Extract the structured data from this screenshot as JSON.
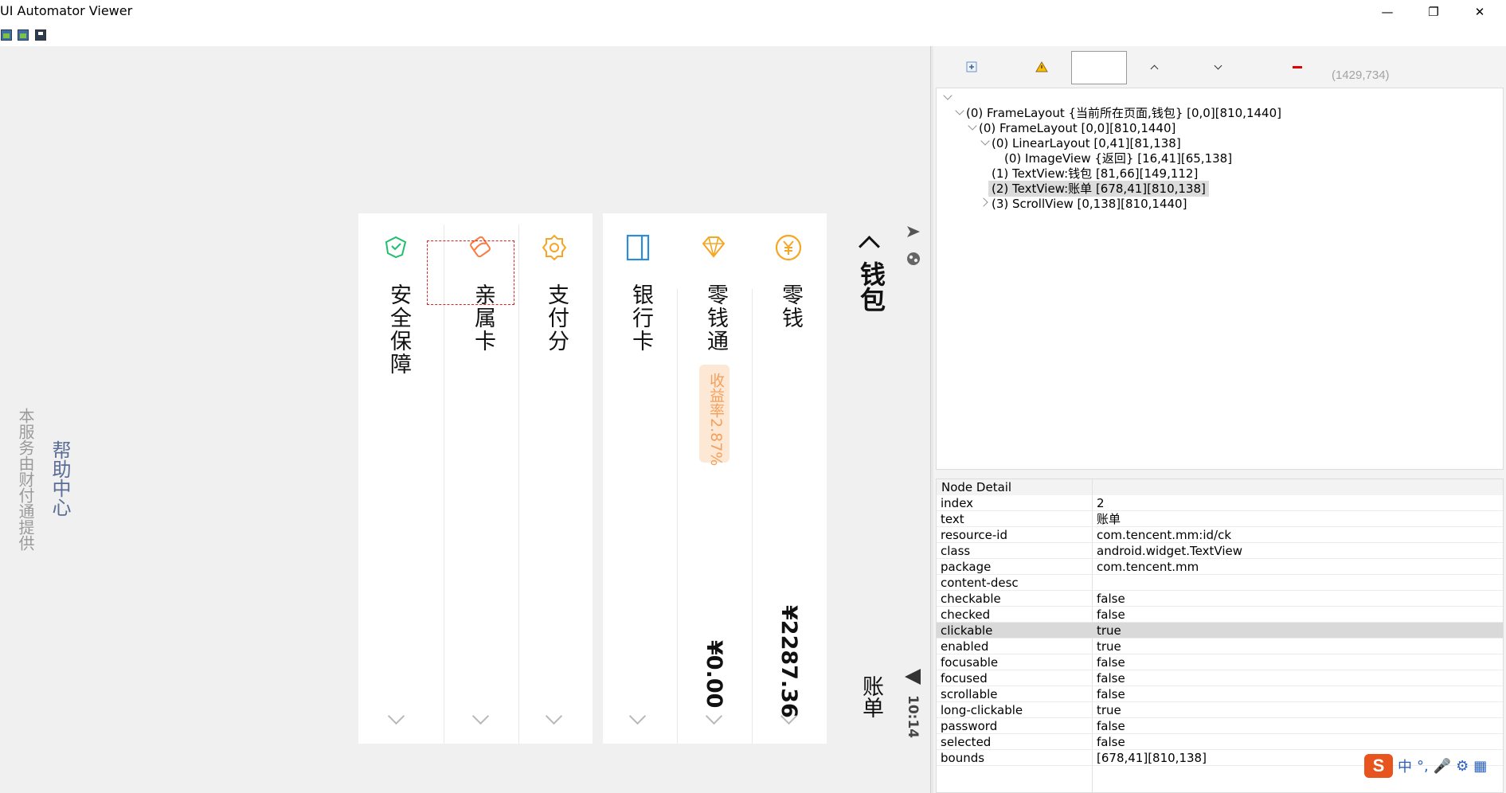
{
  "window": {
    "title": "UI Automator Viewer",
    "minimize_glyph": "—",
    "restore_glyph": "❐",
    "close_glyph": "✕"
  },
  "toolbar": {
    "icons": [
      "device-screenshot-icon",
      "device-screenshot-compressed-icon",
      "save-icon"
    ]
  },
  "phone": {
    "title": "钱包",
    "back_glyph": "〈",
    "bill": "账单",
    "status_time": "10:14",
    "items": [
      {
        "label": "零钱",
        "value": "¥2287.36",
        "icon_color": "#f6a623"
      },
      {
        "label": "零钱通",
        "badge": "收益率2.87%",
        "value": "¥0.00",
        "icon_color": "#f6a623"
      },
      {
        "label": "银行卡",
        "icon_color": "#2f8bd6"
      },
      {
        "label": "支付分",
        "icon_color": "#f6a623"
      },
      {
        "label": "亲属卡",
        "icon_color": "#fb7a3c"
      },
      {
        "label": "安全保障",
        "icon_color": "#1fbf6b"
      }
    ],
    "help_center": "帮助中心",
    "service_note": "本服务由财付通提供"
  },
  "right_toolbar": {
    "coordinate": "(1429,734)"
  },
  "tree": [
    {
      "text": "(0) FrameLayout {当前所在页面,钱包} [0,0][810,1440]"
    },
    {
      "text": "(0) FrameLayout [0,0][810,1440]"
    },
    {
      "text": "(0) LinearLayout [0,41][81,138]"
    },
    {
      "text": "(0) ImageView {返回} [16,41][65,138]"
    },
    {
      "text": "(1) TextView:钱包 [81,66][149,112]"
    },
    {
      "text": "(2) TextView:账单 [678,41][810,138]"
    },
    {
      "text": "(3) ScrollView [0,138][810,1440]"
    }
  ],
  "detail": {
    "header": "Node Detail",
    "rows": [
      {
        "key": "index",
        "value": "2"
      },
      {
        "key": "text",
        "value": "账单"
      },
      {
        "key": "resource-id",
        "value": "com.tencent.mm:id/ck"
      },
      {
        "key": "class",
        "value": "android.widget.TextView"
      },
      {
        "key": "package",
        "value": "com.tencent.mm"
      },
      {
        "key": "content-desc",
        "value": ""
      },
      {
        "key": "checkable",
        "value": "false"
      },
      {
        "key": "checked",
        "value": "false"
      },
      {
        "key": "clickable",
        "value": "true"
      },
      {
        "key": "enabled",
        "value": "true"
      },
      {
        "key": "focusable",
        "value": "false"
      },
      {
        "key": "focused",
        "value": "false"
      },
      {
        "key": "scrollable",
        "value": "false"
      },
      {
        "key": "long-clickable",
        "value": "true"
      },
      {
        "key": "password",
        "value": "false"
      },
      {
        "key": "selected",
        "value": "false"
      },
      {
        "key": "bounds",
        "value": "[678,41][810,138]"
      }
    ]
  },
  "ime": {
    "logo": "S",
    "glyphs": [
      "中",
      "°,",
      "🎤",
      "⚙",
      "▦"
    ]
  }
}
